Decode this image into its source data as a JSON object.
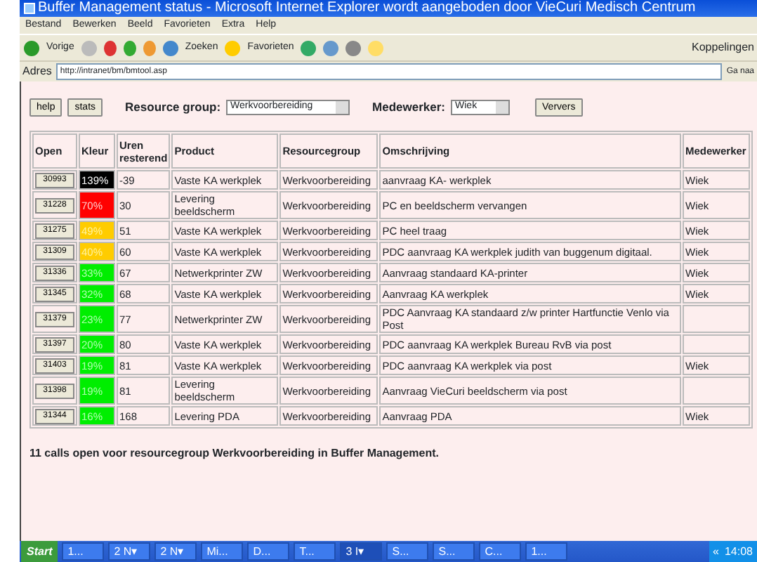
{
  "window": {
    "title": "Buffer Management status - Microsoft Internet Explorer wordt aangeboden door VieCuri Medisch Centrum"
  },
  "menu": [
    "Bestand",
    "Bewerken",
    "Beeld",
    "Favorieten",
    "Extra",
    "Help"
  ],
  "toolbar": {
    "back": "Vorige",
    "search": "Zoeken",
    "favorites": "Favorieten",
    "links": "Koppelingen"
  },
  "address": {
    "label": "Adres",
    "value": "http://intranet/bm/bmtool.asp",
    "go": "Ga naa"
  },
  "controls": {
    "buttons": [
      "help",
      "stats"
    ],
    "resource_label": "Resource group:",
    "resource_value": "Werkvoorbereiding",
    "employee_label": "Medewerker:",
    "employee_value": "Wiek",
    "refresh": "Ververs"
  },
  "table": {
    "columns": [
      "Open",
      "Kleur",
      "Uren resterend",
      "Product",
      "Resourcegroup",
      "Omschrijving",
      "Medewerker"
    ],
    "rows": [
      {
        "open": "30993",
        "kleur": "139%",
        "color": "#000000",
        "uren": "-39",
        "product": "Vaste KA werkplek",
        "group": "Werkvoorbereiding",
        "desc": "aanvraag KA- werkplek",
        "worker": "Wiek"
      },
      {
        "open": "31228",
        "kleur": "70%",
        "color": "#ff0000",
        "uren": "30",
        "product": "Levering beeldscherm",
        "group": "Werkvoorbereiding",
        "desc": "PC en beeldscherm vervangen",
        "worker": "Wiek"
      },
      {
        "open": "31275",
        "kleur": "49%",
        "color": "#ffcc00",
        "uren": "51",
        "product": "Vaste KA werkplek",
        "group": "Werkvoorbereiding",
        "desc": "PC heel traag",
        "worker": "Wiek"
      },
      {
        "open": "31309",
        "kleur": "40%",
        "color": "#ffcc00",
        "uren": "60",
        "product": "Vaste KA werkplek",
        "group": "Werkvoorbereiding",
        "desc": "PDC aanvraag KA werkplek judith van buggenum digitaal.",
        "worker": "Wiek"
      },
      {
        "open": "31336",
        "kleur": "33%",
        "color": "#00ee00",
        "uren": "67",
        "product": "Netwerkprinter ZW",
        "group": "Werkvoorbereiding",
        "desc": "Aanvraag standaard KA-printer",
        "worker": "Wiek"
      },
      {
        "open": "31345",
        "kleur": "32%",
        "color": "#00ee00",
        "uren": "68",
        "product": "Vaste KA werkplek",
        "group": "Werkvoorbereiding",
        "desc": "Aanvraag KA werkplek",
        "worker": "Wiek"
      },
      {
        "open": "31379",
        "kleur": "23%",
        "color": "#00ee00",
        "uren": "77",
        "product": "Netwerkprinter ZW",
        "group": "Werkvoorbereiding",
        "desc": "PDC Aanvraag KA standaard z/w printer Hartfunctie Venlo via Post"
      },
      {
        "open": "31397",
        "kleur": "20%",
        "color": "#00ee00",
        "uren": "80",
        "product": "Vaste KA werkplek",
        "group": "Werkvoorbereiding",
        "desc": "PDC aanvraag KA werkplek Bureau RvB via post"
      },
      {
        "open": "31403",
        "kleur": "19%",
        "color": "#00ee00",
        "uren": "81",
        "product": "Vaste KA werkplek",
        "group": "Werkvoorbereiding",
        "desc": "PDC aanvraag KA werkplek via post",
        "worker": "Wiek"
      },
      {
        "open": "31398",
        "kleur": "19%",
        "color": "#00ee00",
        "uren": "81",
        "product": "Levering beeldscherm",
        "group": "Werkvoorbereiding",
        "desc": "Aanvraag VieCuri beeldscherm via post"
      },
      {
        "open": "31344",
        "kleur": "16%",
        "color": "#00ee00",
        "uren": "168",
        "product": "Levering PDA",
        "group": "Werkvoorbereiding",
        "desc": "Aanvraag PDA",
        "worker": "Wiek"
      }
    ]
  },
  "summary": "11 calls open voor resourcegroup Werkvoorbereiding in Buffer Management.",
  "taskbar": {
    "start": "Start",
    "items": [
      "1...",
      "2 N▾",
      "2 N▾",
      "Mi...",
      "D...",
      "T...",
      "3 I▾",
      "S...",
      "S...",
      "C...",
      "1..."
    ],
    "tray": "«",
    "clock": "14:08"
  }
}
